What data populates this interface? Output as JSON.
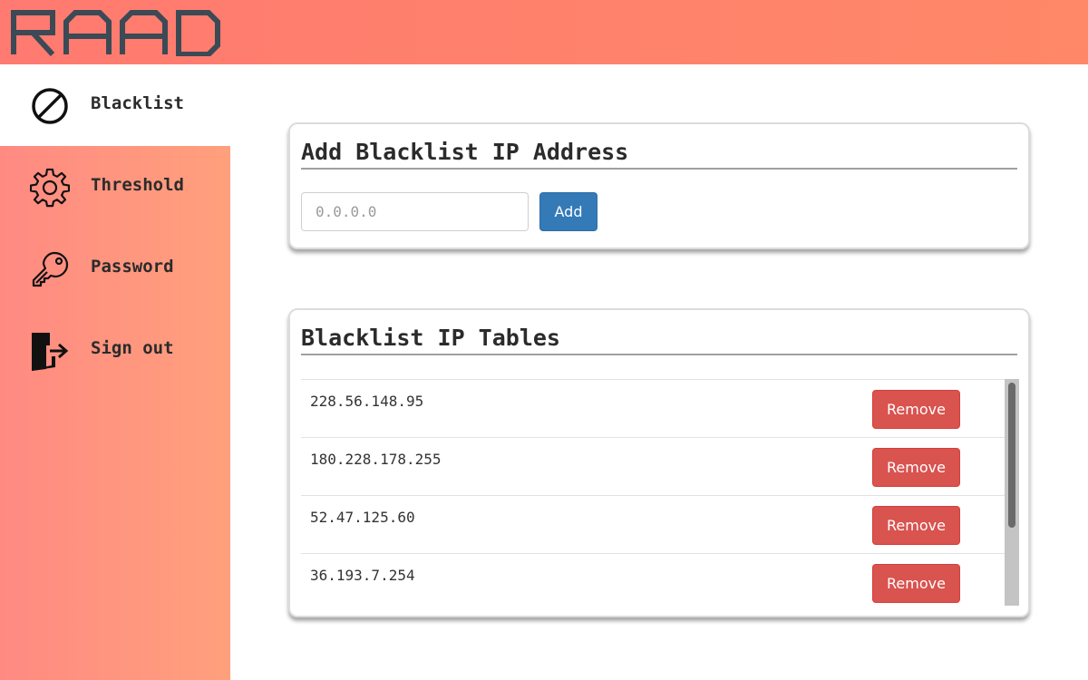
{
  "header": {
    "logo_text": "RAAD",
    "logo_color": "#3b4a55",
    "gradient": [
      "#ff7a70",
      "#ff8868"
    ]
  },
  "sidebar": {
    "items": [
      {
        "label": "Blacklist",
        "icon": "blocked-icon",
        "active": true
      },
      {
        "label": "Threshold",
        "icon": "gear-icon",
        "active": false
      },
      {
        "label": "Password",
        "icon": "key-icon",
        "active": false
      },
      {
        "label": "Sign out",
        "icon": "sign-out-icon",
        "active": false
      }
    ]
  },
  "add_card": {
    "title": "Add Blacklist IP Address",
    "input_placeholder": "0.0.0.0",
    "input_value": "",
    "add_label": "Add"
  },
  "table_card": {
    "title": "Blacklist IP Tables",
    "remove_label": "Remove",
    "rows": [
      {
        "ip": "228.56.148.95"
      },
      {
        "ip": "180.228.178.255"
      },
      {
        "ip": "52.47.125.60"
      },
      {
        "ip": "36.193.7.254"
      }
    ]
  },
  "colors": {
    "primary": "#337ab7",
    "danger": "#d9534f",
    "sidebar": "#ff8a82"
  }
}
